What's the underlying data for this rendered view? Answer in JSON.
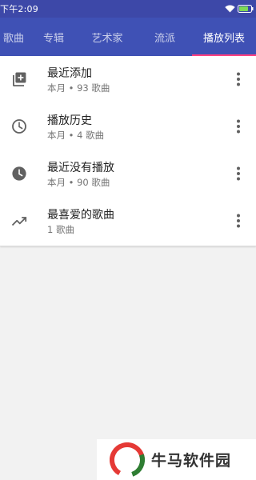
{
  "status_bar": {
    "time": "下午2:09"
  },
  "tabs": [
    {
      "label": "歌曲"
    },
    {
      "label": "专辑"
    },
    {
      "label": "艺术家"
    },
    {
      "label": "流派"
    },
    {
      "label": "播放列表"
    }
  ],
  "active_tab": "播放列表",
  "playlists": [
    {
      "title": "最近添加",
      "subtitle": "本月 • 93 歌曲",
      "icon": "playlist-add-icon"
    },
    {
      "title": "播放历史",
      "subtitle": "本月 • 4 歌曲",
      "icon": "clock-outline-icon"
    },
    {
      "title": "最近没有播放",
      "subtitle": "本月 • 90 歌曲",
      "icon": "clock-filled-icon"
    },
    {
      "title": "最喜爱的歌曲",
      "subtitle": "1 歌曲",
      "icon": "trending-up-icon"
    }
  ],
  "watermark": {
    "text": "牛马软件园"
  },
  "colors": {
    "app_bar": "#3f51b5",
    "status_bar": "#3d48a8",
    "tab_indicator": "#ff4081"
  }
}
